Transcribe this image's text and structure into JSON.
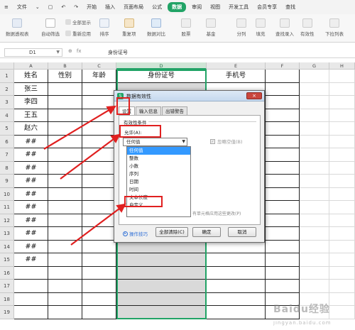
{
  "menu": {
    "file_label": "文件",
    "tabs": [
      "开始",
      "插入",
      "页面布局",
      "公式",
      "数据",
      "审阅",
      "视图",
      "开发工具",
      "会员专享"
    ],
    "active_tab": "数据",
    "search_label": "查找"
  },
  "ribbon": {
    "pivot": "数据透视表",
    "autofilter": "自动筛选",
    "show_all": "全部显示",
    "reapply": "重新应用",
    "sort": "排序",
    "duplicates": "重复项",
    "compare": "数据对比",
    "stock": "股票",
    "fund": "基金",
    "split": "分列",
    "fill": "填充",
    "lookup": "查找录入",
    "validity": "有效性",
    "dropdown": "下拉列表"
  },
  "formula_bar": {
    "cell_ref": "D1",
    "content": "身份证号"
  },
  "sheet": {
    "columns": [
      "A",
      "B",
      "C",
      "D",
      "E",
      "F",
      "G",
      "H"
    ],
    "selected_column": "D",
    "rows": [
      "1",
      "2",
      "3",
      "4",
      "5",
      "6",
      "7",
      "8",
      "9",
      "10",
      "11",
      "12",
      "13",
      "14",
      "15",
      "16",
      "17",
      "18",
      "19"
    ],
    "headers": [
      "姓名",
      "性别",
      "年龄",
      "身份证号",
      "手机号"
    ],
    "names": [
      "张三",
      "李四",
      "王五",
      "赵六",
      "##",
      "##",
      "##",
      "##",
      "##",
      "##",
      "##",
      "##",
      "##",
      "##"
    ]
  },
  "dialog": {
    "title": "数据有效性",
    "close": "×",
    "tabs": [
      "设置",
      "输入信息",
      "出错警告"
    ],
    "active_tab": "设置",
    "section_title": "有效性条件",
    "allow_label": "允许(A):",
    "allow_value": "任何值",
    "ignore_blank": "忽略空值(B)",
    "options": [
      "任何值",
      "整数",
      "小数",
      "序列",
      "日期",
      "时间",
      "文本长度",
      "自定义"
    ],
    "highlighted_option": "任何值",
    "apply_all_note": "有单元格应用这些更改(P)",
    "tips": "操作技巧",
    "clear_all": "全部清除(C)",
    "ok": "确定",
    "cancel": "取消"
  },
  "watermark": "Baidu经验",
  "watermark_sub": "jingyan.baidu.com",
  "colors": {
    "accent": "#21a366",
    "annotation_red": "#e02020",
    "selected_column_fill": "#d9d9d9",
    "dropdown_highlight": "#3399ff"
  }
}
